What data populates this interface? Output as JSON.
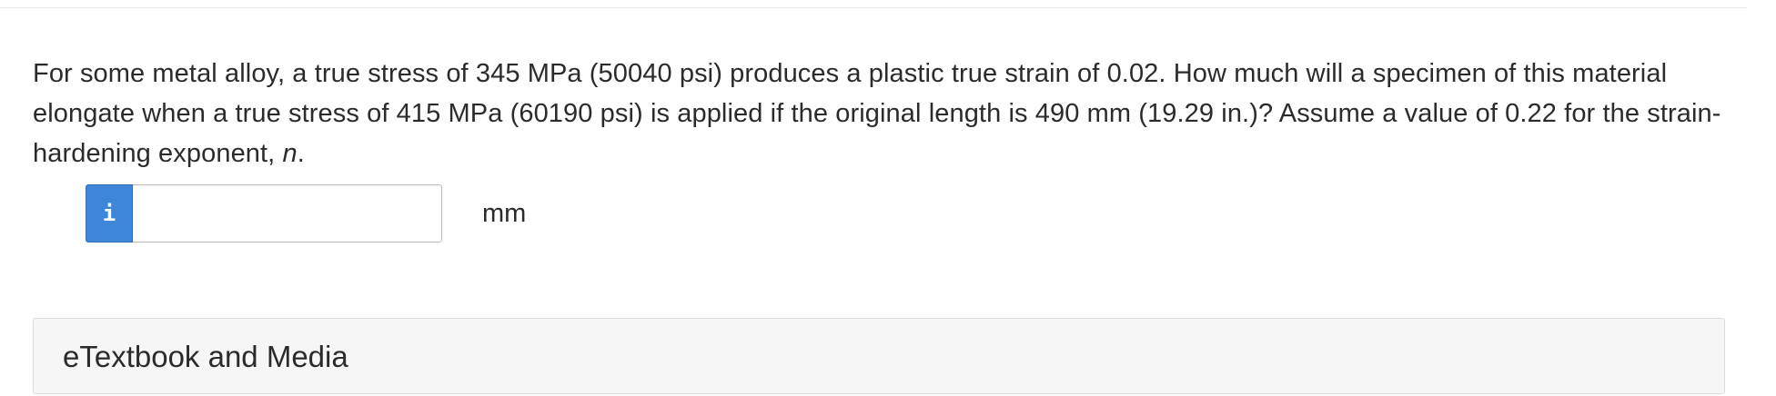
{
  "question": {
    "text_before_var": "For some metal alloy, a true stress of 345 MPa (50040 psi) produces a plastic true strain of 0.02. How much will a specimen of this material elongate when a true stress of 415 MPa (60190 psi) is applied if the original length is 490 mm (19.29 in.)? Assume a value of 0.22 for the strain-hardening exponent, ",
    "variable": "n",
    "text_after_var": "."
  },
  "answer": {
    "info_icon_glyph": "i",
    "input_value": "",
    "input_placeholder": "",
    "unit": "mm"
  },
  "resources": {
    "etextbook_label": "eTextbook and Media"
  },
  "colors": {
    "info_button": "#3d86d8",
    "panel_background": "#f6f6f6"
  }
}
